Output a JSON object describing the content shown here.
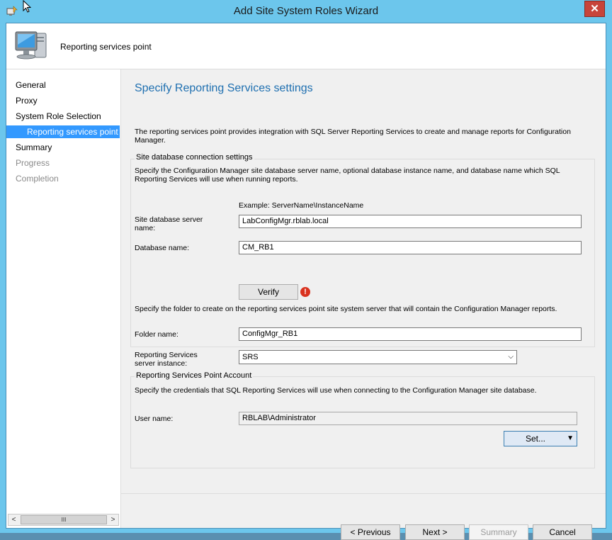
{
  "window": {
    "title": "Add Site System Roles Wizard",
    "close_glyph": "✕"
  },
  "header": {
    "title": "Reporting services point",
    "icon": "computer-monitor-icon"
  },
  "nav": {
    "items": [
      {
        "label": "General",
        "state": "normal"
      },
      {
        "label": "Proxy",
        "state": "normal"
      },
      {
        "label": "System Role Selection",
        "state": "normal"
      },
      {
        "label": "Reporting services point",
        "state": "selected"
      },
      {
        "label": "Summary",
        "state": "normal"
      },
      {
        "label": "Progress",
        "state": "disabled"
      },
      {
        "label": "Completion",
        "state": "disabled"
      }
    ],
    "scroll_left": "<",
    "scroll_right": ">",
    "scroll_thumb": "III"
  },
  "main": {
    "title": "Specify Reporting Services settings",
    "intro": "The reporting services point provides integration with SQL Server Reporting Services to create and manage reports for Configuration Manager.",
    "db_group": {
      "title": "Site database connection settings",
      "description": "Specify the Configuration Manager site database server name, optional database instance name, and database name which SQL Reporting Services will use when running reports.",
      "example": "Example: ServerName\\InstanceName",
      "server_label": "Site database server name:",
      "server_value": "LabConfigMgr.rblab.local",
      "db_label": "Database name:",
      "db_value": "CM_RB1",
      "verify_label": "Verify",
      "warn_glyph": "!",
      "folder_description": "Specify the folder to create on the reporting services point site system server that will contain the Configuration Manager reports.",
      "folder_label": "Folder name:",
      "folder_value": "ConfigMgr_RB1"
    },
    "instance_label": "Reporting Services server instance:",
    "instance_value": "SRS",
    "account_group": {
      "title": "Reporting Services Point Account",
      "description": "Specify the credentials that SQL Reporting Services will use when connecting to the Configuration Manager site database.",
      "user_label": "User name:",
      "user_value": "RBLAB\\Administrator",
      "set_label": "Set..."
    }
  },
  "footer": {
    "previous": "< Previous",
    "next": "Next >",
    "summary": "Summary",
    "cancel": "Cancel"
  },
  "colors": {
    "accent": "#3399ff",
    "title_blue": "#1e6fb0",
    "window_frame": "#6cc6ec",
    "warning": "#d9321f"
  }
}
